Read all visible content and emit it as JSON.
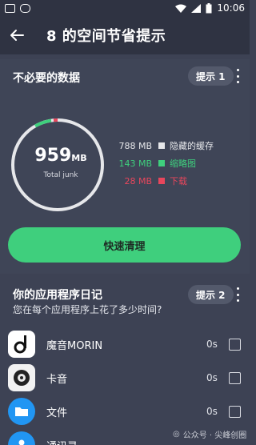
{
  "status_bar": {
    "time": "10:06"
  },
  "app_bar": {
    "title": "8 的空间节省提示"
  },
  "unneeded": {
    "title": "不必要的数据",
    "hint_label": "提示 1",
    "gauge": {
      "value": "959",
      "unit": "MB",
      "label": "Total junk"
    },
    "legend": [
      {
        "size": "788 MB",
        "label": "隐藏的缓存",
        "color": "#e6e7ea"
      },
      {
        "size": "143 MB",
        "label": "缩略图",
        "color": "#3fcf7d"
      },
      {
        "size": "28 MB",
        "label": "下载",
        "color": "#e8465c"
      }
    ],
    "clean_button": "快速清理"
  },
  "diary": {
    "title": "你的应用程序日记",
    "hint_label": "提示 2",
    "subtitle": "您在每个应用程序上花了多少时间?",
    "apps": [
      {
        "name": "魔音MORIN",
        "time": "0s"
      },
      {
        "name": "卡音",
        "time": "0s"
      },
      {
        "name": "文件",
        "time": "0s"
      },
      {
        "name": "通讯录",
        "time": ""
      }
    ]
  },
  "watermark": "公众号 · 尖峰创圈",
  "colors": {
    "accent_green": "#3fcf7d",
    "accent_red": "#e8465c",
    "bg": "#3d4254"
  }
}
